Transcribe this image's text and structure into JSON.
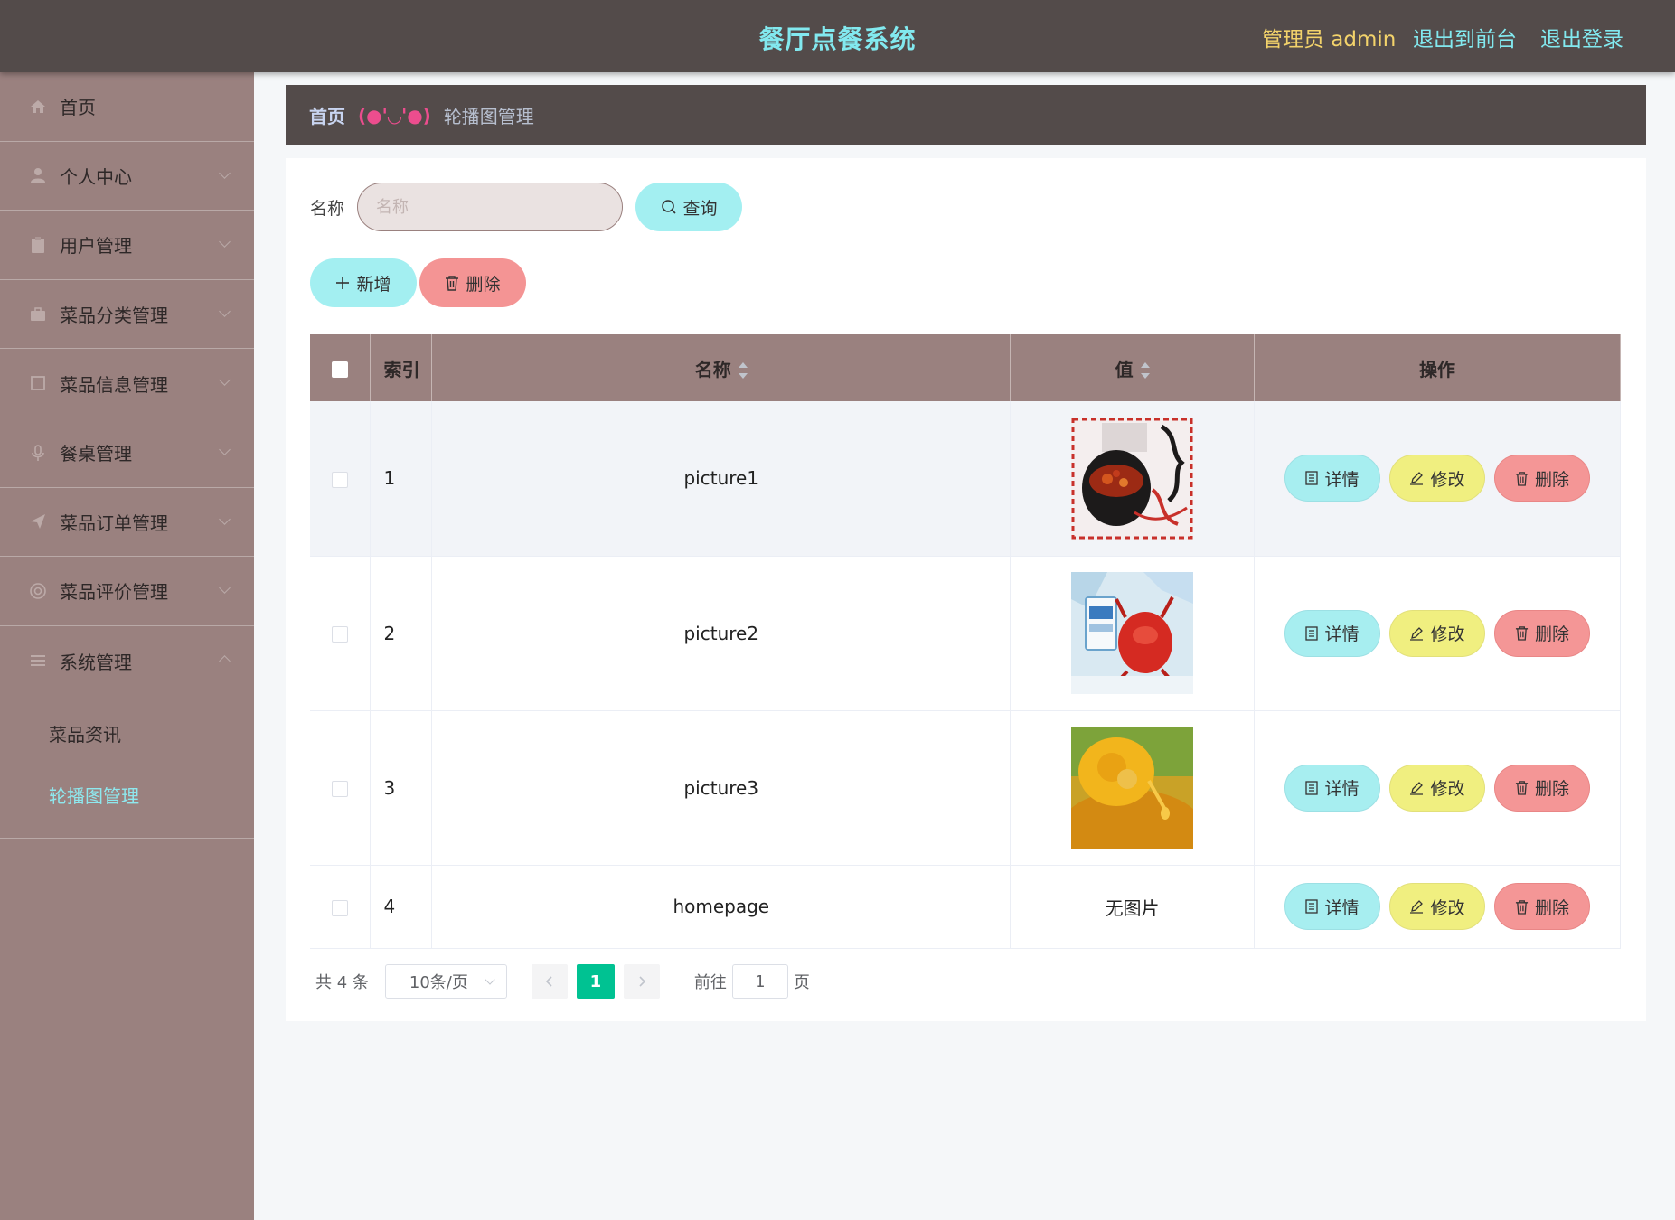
{
  "header": {
    "title": "餐厅点餐系统",
    "user_label": "管理员 admin",
    "to_front_label": "退出到前台",
    "logout_label": "退出登录"
  },
  "sidebar": {
    "items": [
      {
        "label": "首页",
        "icon": "home-icon"
      },
      {
        "label": "个人中心",
        "icon": "user-icon"
      },
      {
        "label": "用户管理",
        "icon": "clipboard-icon"
      },
      {
        "label": "菜品分类管理",
        "icon": "briefcase-icon"
      },
      {
        "label": "菜品信息管理",
        "icon": "square-icon"
      },
      {
        "label": "餐桌管理",
        "icon": "microphone-icon"
      },
      {
        "label": "菜品订单管理",
        "icon": "send-icon"
      },
      {
        "label": "菜品评价管理",
        "icon": "target-icon"
      },
      {
        "label": "系统管理",
        "icon": "menu-icon"
      }
    ],
    "sub_items": [
      {
        "label": "菜品资讯"
      },
      {
        "label": "轮播图管理"
      }
    ]
  },
  "breadcrumb": {
    "home": "首页",
    "separator": "(●'◡'●)",
    "current": "轮播图管理"
  },
  "search": {
    "label": "名称",
    "placeholder": "名称",
    "query_label": "查询"
  },
  "actions": {
    "add_label": "新增",
    "delete_label": "删除"
  },
  "table": {
    "columns": [
      "索引",
      "名称",
      "值",
      "操作"
    ],
    "rows": [
      {
        "index": "1",
        "name": "picture1",
        "value": "image",
        "image": "xiangcai-poster"
      },
      {
        "index": "2",
        "name": "picture2",
        "value": "image",
        "image": "crayfish-ice"
      },
      {
        "index": "3",
        "name": "picture3",
        "value": "image",
        "image": "golden-soup"
      },
      {
        "index": "4",
        "name": "homepage",
        "value": "无图片",
        "image": ""
      }
    ],
    "row_actions": {
      "detail": "详情",
      "edit": "修改",
      "delete": "删除"
    }
  },
  "pagination": {
    "total": "共 4 条",
    "page_size": "10条/页",
    "current_page": "1",
    "goto_label": "前往",
    "goto_value": "1",
    "unit": "页"
  },
  "colors": {
    "header_bg": "#534b4a",
    "sidebar_bg": "#9a817f",
    "title_color": "#82e9ef",
    "accent_cyan": "#a3eff1",
    "accent_red": "#f49494",
    "accent_yellow": "#f0ef80",
    "pager_active": "#00c292"
  }
}
